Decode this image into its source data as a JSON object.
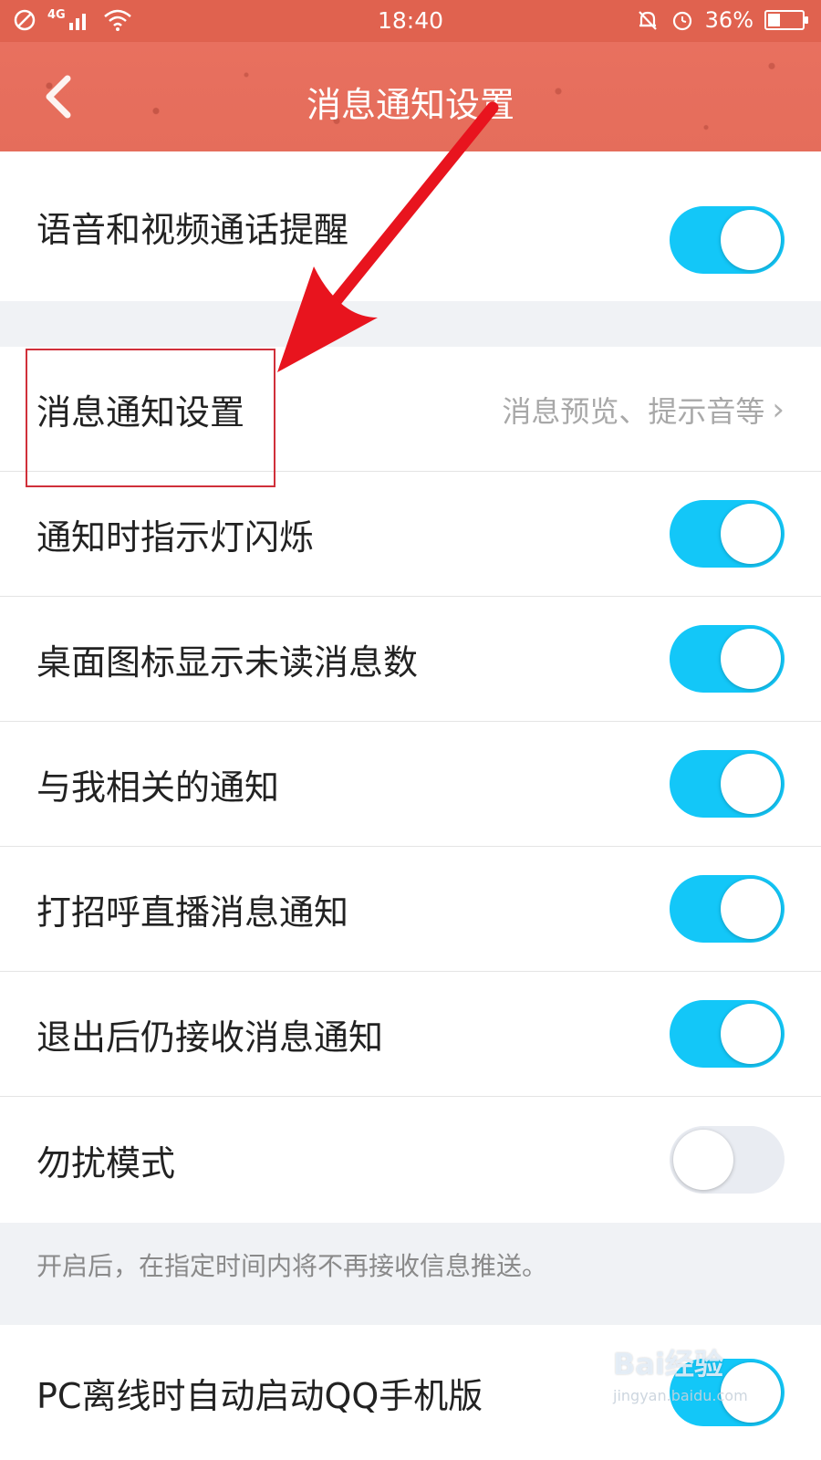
{
  "status_bar": {
    "time": "18:40",
    "network": "4G",
    "battery": "36%",
    "battery_level": 0.36
  },
  "nav": {
    "title": "消息通知设置",
    "back_icon": "chevron-left-icon"
  },
  "rows": {
    "call_reminder": {
      "label": "语音和视频通话提醒",
      "on": true
    },
    "message_settings": {
      "label": "消息通知设置",
      "detail": "消息预览、提示音等"
    },
    "led_blink": {
      "label": "通知时指示灯闪烁",
      "on": true
    },
    "badge_unread": {
      "label": "桌面图标显示未读消息数",
      "on": true
    },
    "related_notify": {
      "label": "与我相关的通知",
      "on": true
    },
    "greeting_live": {
      "label": "打招呼直播消息通知",
      "on": true
    },
    "receive_after_exit": {
      "label": "退出后仍接收消息通知",
      "on": true
    },
    "dnd_mode": {
      "label": "勿扰模式",
      "on": false
    },
    "pc_offline": {
      "label": "PC离线时自动启动QQ手机版",
      "on": true
    }
  },
  "dnd_hint": "开启后，在指定时间内将不再接收信息推送。",
  "watermark": {
    "main": "Bai经验",
    "sub": "jingyan.baidu.com"
  },
  "colors": {
    "header": "#e8705f",
    "toggle_on": "#13c7f8",
    "toggle_off": "#e9ecf2",
    "annotation": "#e8141e"
  }
}
